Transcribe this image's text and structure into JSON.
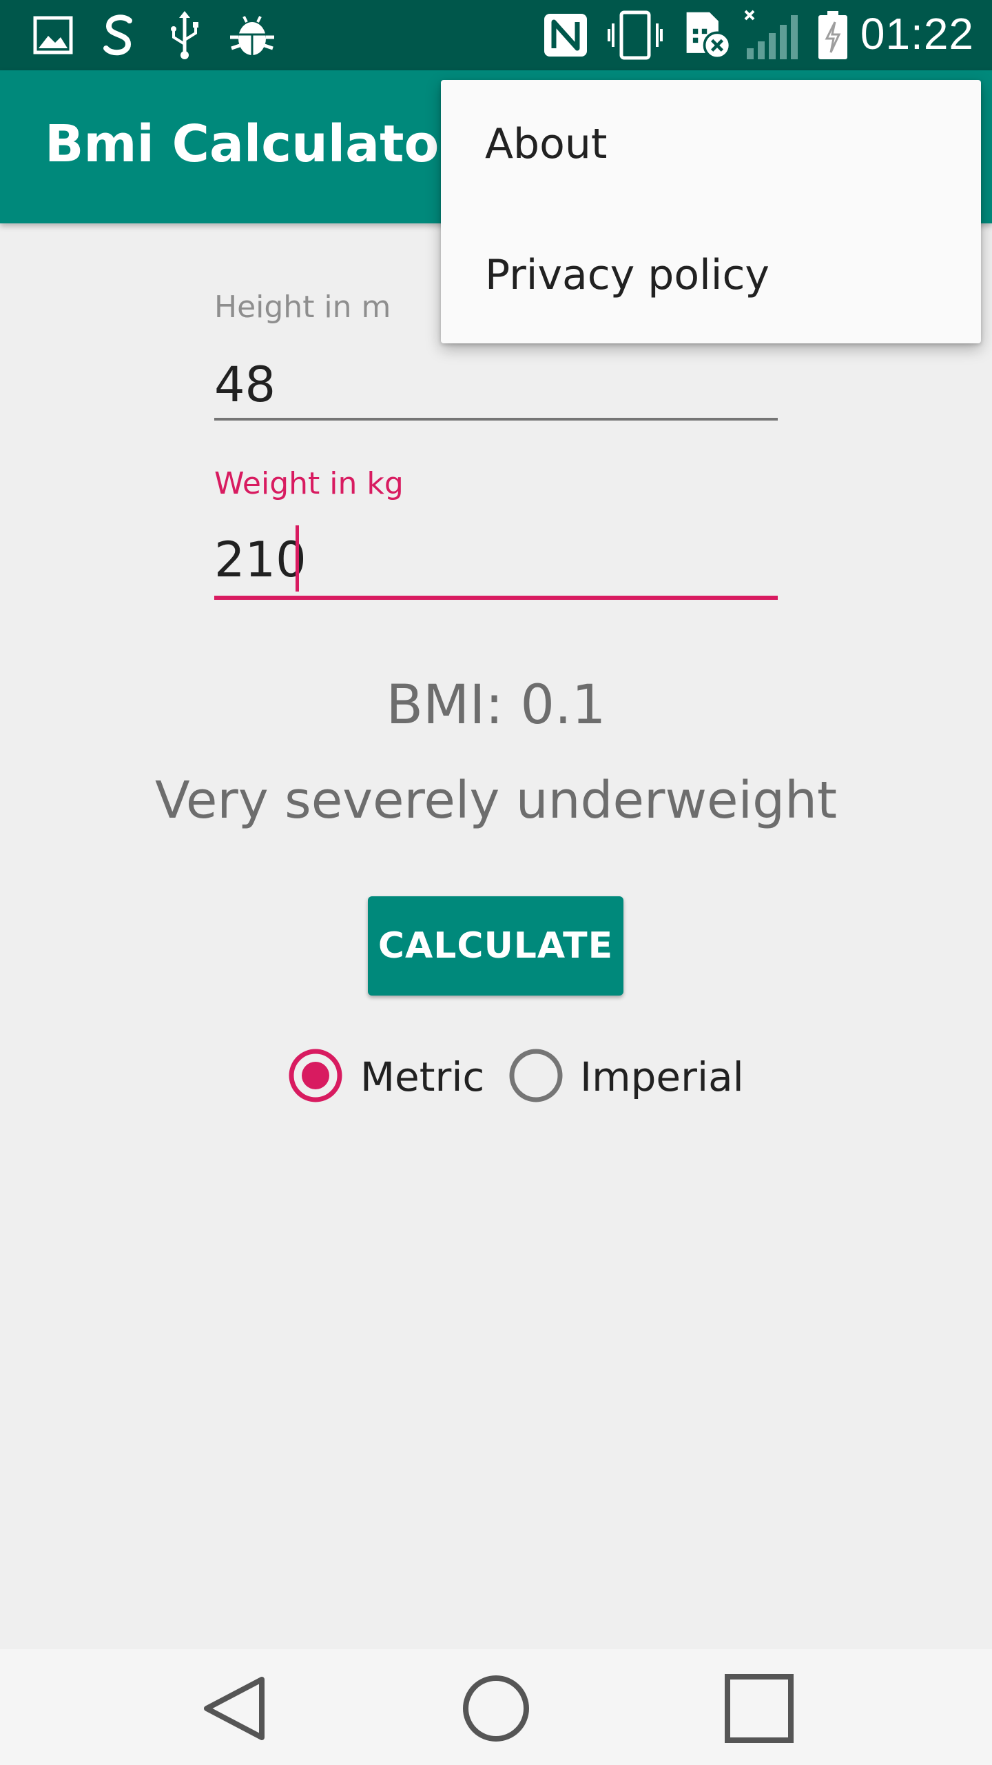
{
  "status_bar": {
    "time": "01:22",
    "left_icons": [
      "gallery-icon",
      "swiftkey-icon",
      "usb-icon",
      "android-debug-icon"
    ],
    "right_icons": [
      "nfc-icon",
      "vibrate-icon",
      "no-sim-icon",
      "signal-icon",
      "battery-charging-icon"
    ]
  },
  "app_bar": {
    "title": "Bmi Calculator",
    "background": "#00897b"
  },
  "overflow_menu": {
    "items": [
      {
        "label": "About"
      },
      {
        "label": "Privacy policy"
      }
    ]
  },
  "form": {
    "height": {
      "label": "Height in m",
      "value": "48"
    },
    "weight": {
      "label": "Weight in kg",
      "value": "210",
      "focused": true
    }
  },
  "result": {
    "bmi": "BMI: 0.1",
    "category": "Very severely underweight"
  },
  "calculate_button": {
    "label": "CALCULATE"
  },
  "units": {
    "options": [
      {
        "label": "Metric",
        "selected": true
      },
      {
        "label": "Imperial",
        "selected": false
      }
    ]
  },
  "nav_bar": {
    "buttons": [
      "back-icon",
      "home-icon",
      "recents-icon"
    ]
  },
  "colors": {
    "status_bar": "#00574b",
    "primary": "#00897b",
    "accent": "#d81b60",
    "background": "#efefef"
  }
}
